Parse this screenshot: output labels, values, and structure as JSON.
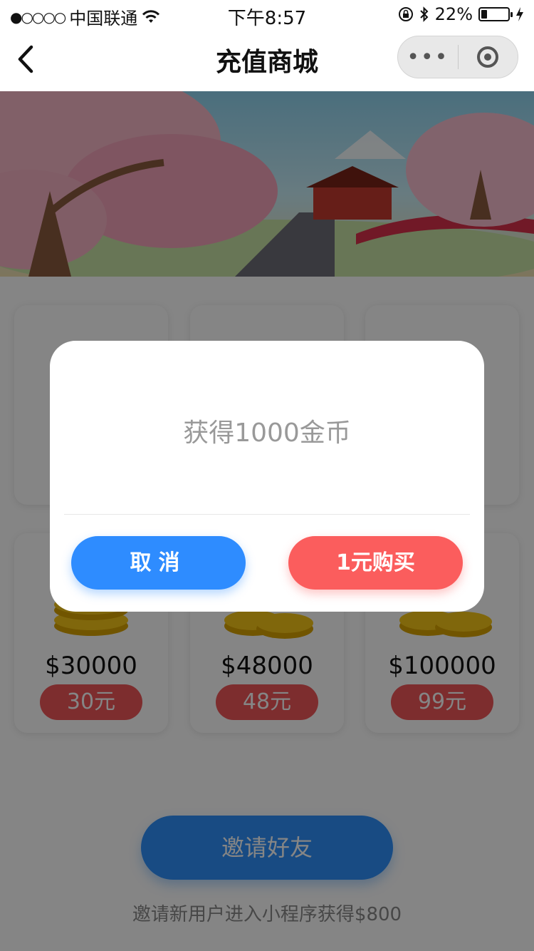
{
  "status_bar": {
    "signal_dots": "●○○○○",
    "carrier": "中国联通",
    "time": "下午8:57",
    "battery": "22%",
    "battery_level": 0.22
  },
  "nav": {
    "title": "充值商城",
    "more_glyph": "•••"
  },
  "products": [
    {
      "price": "",
      "rmb": ""
    },
    {
      "price": "",
      "rmb": ""
    },
    {
      "price": "",
      "rmb": ""
    },
    {
      "price": "$30000",
      "rmb": "30元"
    },
    {
      "price": "$48000",
      "rmb": "48元"
    },
    {
      "price": "$100000",
      "rmb": "99元"
    }
  ],
  "invite": {
    "button": "邀请好友",
    "tip": "邀请新用户进入小程序获得$800"
  },
  "modal": {
    "message": "获得1000金币",
    "cancel": "取消",
    "buy": "1元购买"
  },
  "colors": {
    "primary_blue": "#2e8cff",
    "buy_red": "#fb5d5d",
    "tag_red": "#f05658"
  }
}
